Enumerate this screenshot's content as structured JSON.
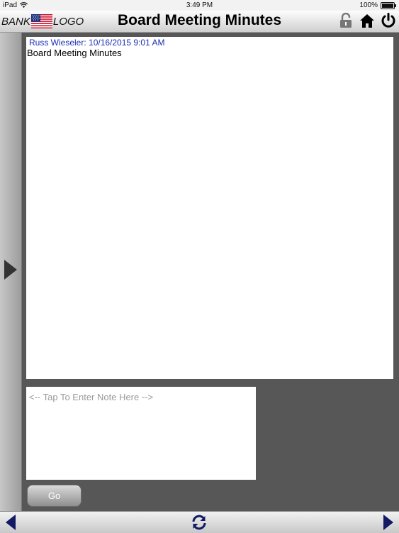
{
  "status_bar": {
    "device": "iPad",
    "time": "3:49 PM",
    "battery": "100%",
    "battery_level": 1.0
  },
  "header": {
    "logo_left": "BANK",
    "logo_right": "LOGO",
    "title": "Board Meeting Minutes",
    "icons": [
      "unlock-icon",
      "home-icon",
      "power-icon"
    ]
  },
  "note": {
    "author_line": "Russ Wieseler: 10/16/2015 9:01 AM",
    "body": "Board Meeting Minutes"
  },
  "entry": {
    "placeholder": "<-- Tap To Enter Note Here -->",
    "value": ""
  },
  "go_button": {
    "label": "Go"
  },
  "colors": {
    "accent": "#1a2eb8",
    "footer_arrow": "#121a64"
  }
}
